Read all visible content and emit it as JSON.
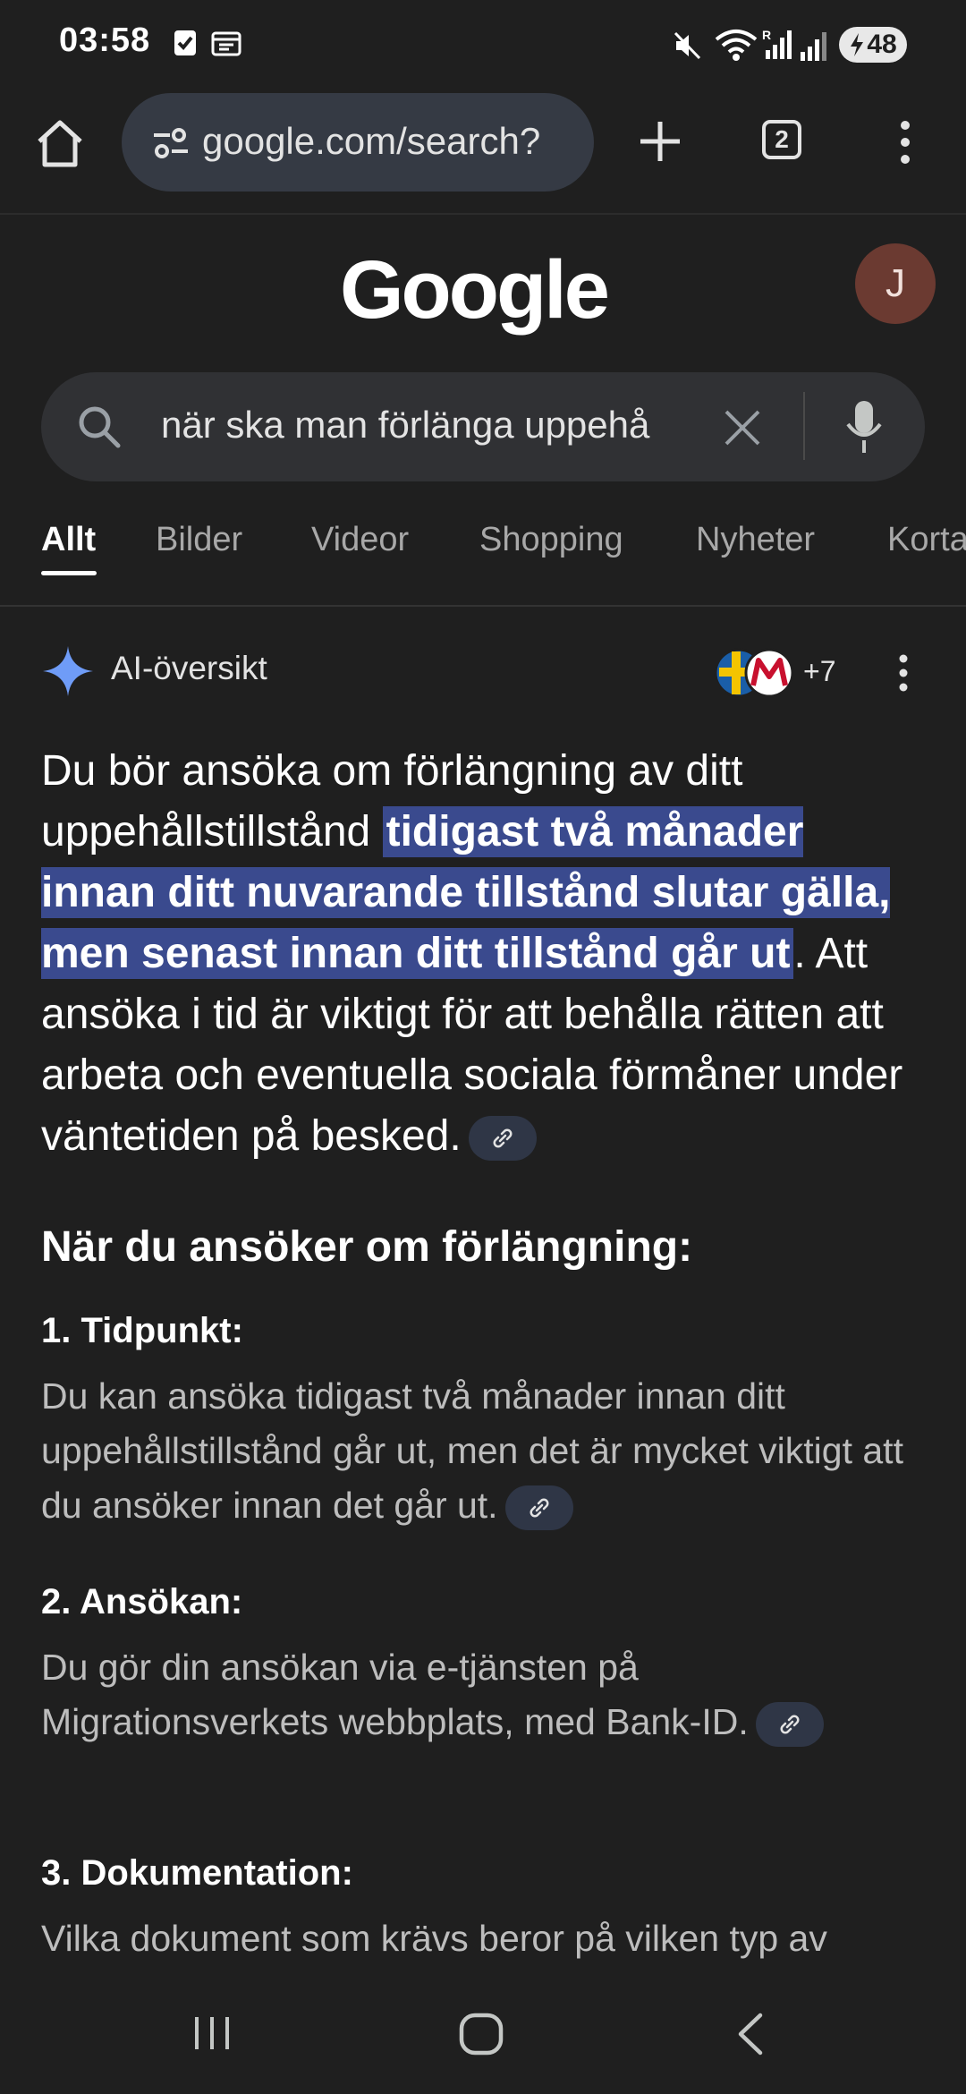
{
  "status_bar": {
    "time": "03:58",
    "battery": "48"
  },
  "browser": {
    "url": "google.com/search?",
    "tab_count": "2"
  },
  "google": {
    "logo": "Google",
    "avatar_letter": "J",
    "search_query": "när ska man förlänga uppehå",
    "tabs": [
      "Allt",
      "Bilder",
      "Videor",
      "Shopping",
      "Nyheter",
      "Korta"
    ]
  },
  "ai_overview": {
    "title": "AI-översikt",
    "source_count": "+7",
    "answer_pre": "Du bör ansöka om förlängning av ditt uppehållstillstånd ",
    "answer_highlight": "tidigast två månader innan ditt nuvarande tillstånd slutar gälla, men senast innan ditt tillstånd går ut",
    "answer_post": ". Att ansöka i tid är viktigt för att behålla rätten att arbeta och eventuella sociala förmåner under väntetiden på besked.",
    "section_heading": "När du ansöker om förlängning:",
    "steps": [
      {
        "title": "1. Tidpunkt:",
        "text": "Du kan ansöka tidigast två månader innan ditt uppehållstillstånd går ut, men det är mycket viktigt att du ansöker innan det går ut."
      },
      {
        "title": "2. Ansökan:",
        "text": "Du gör din ansökan via e-tjänsten på Migrationsverkets webbplats, med Bank-ID."
      },
      {
        "title": "3. Dokumentation:",
        "text": "Vilka dokument som krävs beror på vilken typ av"
      }
    ]
  },
  "colors": {
    "background": "#1f1f1f",
    "highlight": "#3a4a8e",
    "search_box": "#303134",
    "omnibox": "#353a44"
  }
}
